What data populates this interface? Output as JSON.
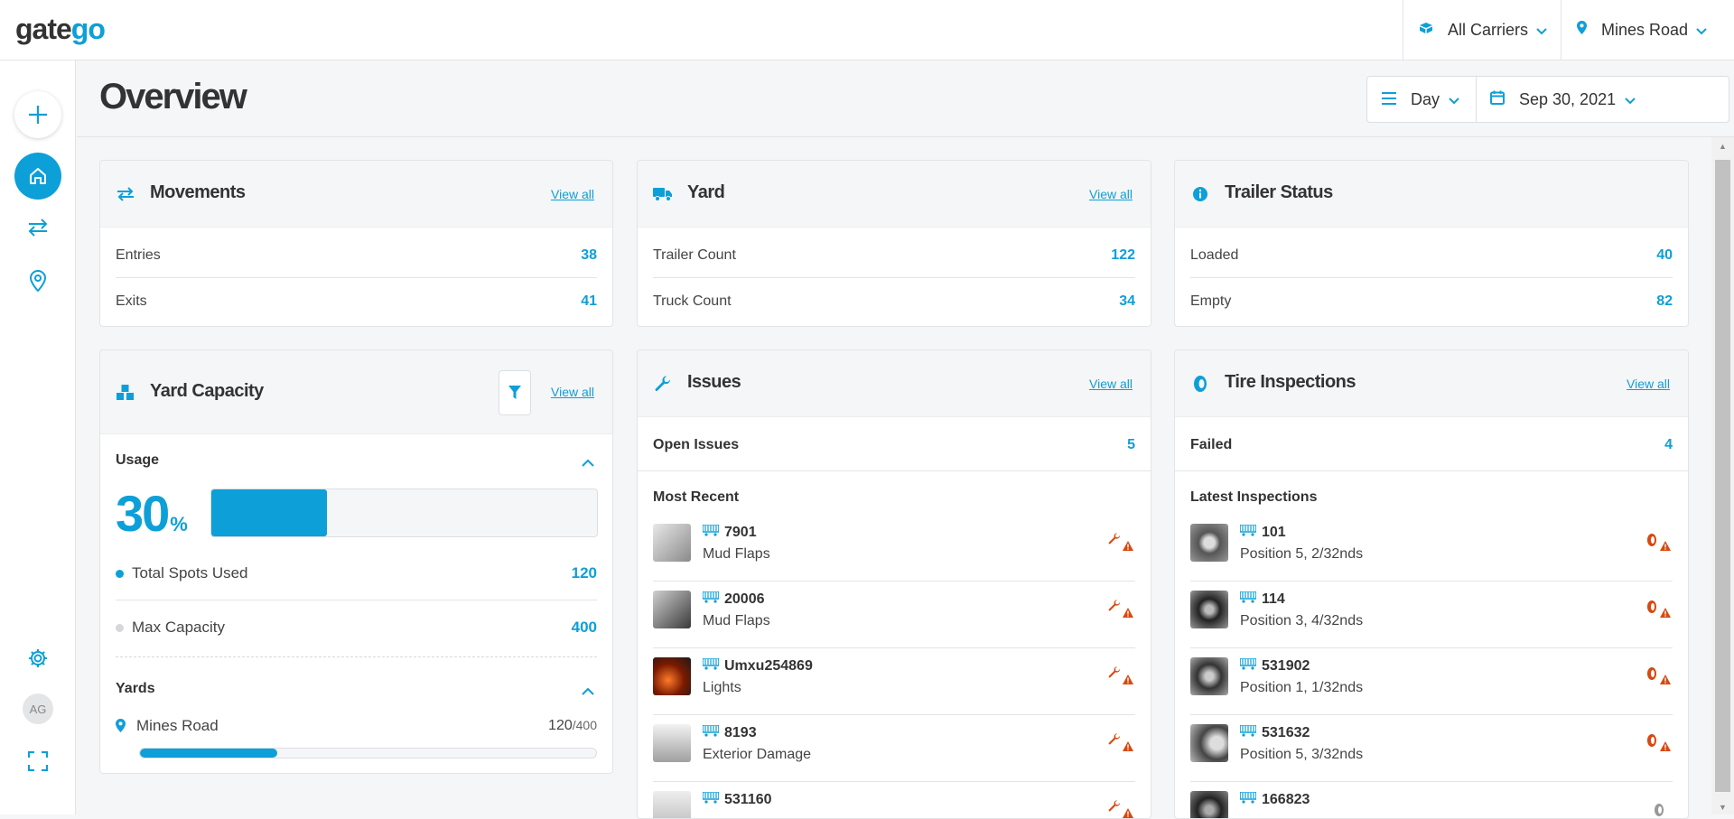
{
  "app": {
    "logo_text": "gate",
    "logo_accent": "go"
  },
  "topbar": {
    "carriers_label": "All Carriers",
    "location_label": "Mines Road"
  },
  "sidebar": {
    "avatar_initials": "AG"
  },
  "header": {
    "title": "Overview",
    "period_label": "Day",
    "date_label": "Sep 30, 2021"
  },
  "movements": {
    "title": "Movements",
    "view_all": "View all",
    "rows": [
      {
        "label": "Entries",
        "value": "38"
      },
      {
        "label": "Exits",
        "value": "41"
      }
    ]
  },
  "yard": {
    "title": "Yard",
    "view_all": "View all",
    "rows": [
      {
        "label": "Trailer Count",
        "value": "122"
      },
      {
        "label": "Truck Count",
        "value": "34"
      }
    ]
  },
  "trailer_status": {
    "title": "Trailer Status",
    "rows": [
      {
        "label": "Loaded",
        "value": "40"
      },
      {
        "label": "Empty",
        "value": "82"
      }
    ]
  },
  "yard_capacity": {
    "title": "Yard Capacity",
    "view_all": "View all",
    "usage_label": "Usage",
    "usage_pct": "30",
    "usage_pct_symbol": "%",
    "usage_fraction": 0.3,
    "total_spots_label": "Total Spots Used",
    "total_spots_value": "120",
    "max_capacity_label": "Max Capacity",
    "max_capacity_value": "400",
    "yards_label": "Yards",
    "yards": [
      {
        "name": "Mines Road",
        "used": "120",
        "capacity": "/400",
        "fraction": 0.3
      }
    ]
  },
  "issues": {
    "title": "Issues",
    "view_all": "View all",
    "open_label": "Open Issues",
    "open_value": "5",
    "recent_label": "Most Recent",
    "items": [
      {
        "id": "7901",
        "desc": "Mud Flaps"
      },
      {
        "id": "20006",
        "desc": "Mud Flaps"
      },
      {
        "id": "Umxu254869",
        "desc": "Lights"
      },
      {
        "id": "8193",
        "desc": "Exterior Damage"
      },
      {
        "id": "531160",
        "desc": ""
      }
    ]
  },
  "tire_inspections": {
    "title": "Tire Inspections",
    "view_all": "View all",
    "failed_label": "Failed",
    "failed_value": "4",
    "latest_label": "Latest Inspections",
    "items": [
      {
        "id": "101",
        "desc": "Position 5, 2/32nds"
      },
      {
        "id": "114",
        "desc": "Position 3, 4/32nds"
      },
      {
        "id": "531902",
        "desc": "Position 1, 1/32nds"
      },
      {
        "id": "531632",
        "desc": "Position 5, 3/32nds"
      },
      {
        "id": "166823",
        "desc": ""
      }
    ]
  },
  "colors": {
    "accent": "#0d9fd8",
    "warning": "#d9480f"
  }
}
